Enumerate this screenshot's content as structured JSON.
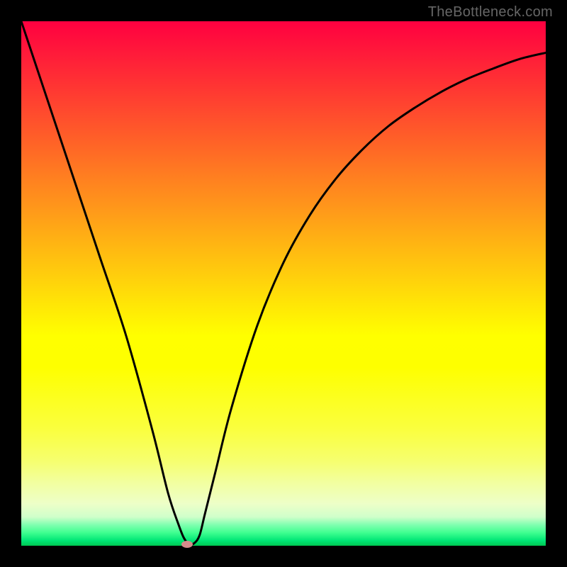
{
  "watermark": "TheBottleneck.com",
  "chart_data": {
    "type": "line",
    "title": "",
    "xlabel": "",
    "ylabel": "",
    "xlim": [
      0,
      100
    ],
    "ylim": [
      0,
      100
    ],
    "axes_visible": false,
    "background": "rainbow-gradient-vertical",
    "series": [
      {
        "name": "bottleneck-curve",
        "color": "#000000",
        "x": [
          0,
          5,
          10,
          15,
          20,
          25,
          28,
          30,
          31,
          32,
          33,
          34,
          35,
          37,
          40,
          45,
          50,
          55,
          60,
          65,
          70,
          75,
          80,
          85,
          90,
          95,
          100
        ],
        "y": [
          100,
          85,
          70,
          55,
          40,
          22,
          10,
          4,
          1.5,
          0.3,
          0.5,
          2,
          6,
          14,
          26,
          42,
          54,
          63,
          70,
          75.5,
          80,
          83.5,
          86.5,
          89,
          91,
          92.8,
          94
        ]
      }
    ],
    "marker": {
      "name": "optimal-point",
      "x": 31.6,
      "y": 0.3,
      "color": "#d68b8b"
    }
  }
}
